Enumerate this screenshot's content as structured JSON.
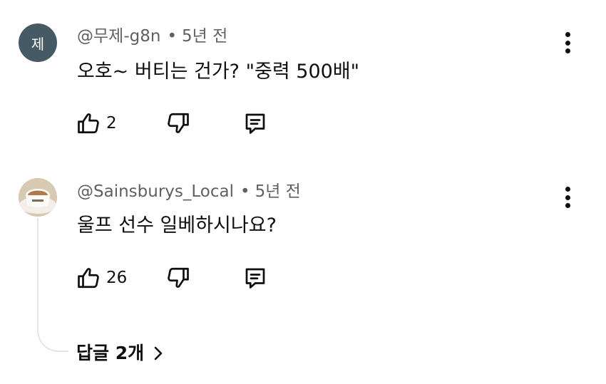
{
  "comments": [
    {
      "avatar_letter": "제",
      "author": "@무제-g8n",
      "separator": "•",
      "time": "5년 전",
      "text": "오호~ 버티는 건가? \"중력 500배\"",
      "likes": "2",
      "avatar_color": "#455a64"
    },
    {
      "avatar_letter": "",
      "author": "@Sainsburys_Local",
      "separator": "•",
      "time": "5년 전",
      "text": "울프 선수 일베하시나요?",
      "likes": "26",
      "avatar_image": "coffee-cup-photo"
    }
  ],
  "replies": {
    "label": "답글 2개"
  },
  "icons": {
    "like": "thumb-up-icon",
    "dislike": "thumb-down-icon",
    "reply": "comment-icon",
    "more": "more-vert-icon",
    "expand": "chevron-right-icon"
  }
}
